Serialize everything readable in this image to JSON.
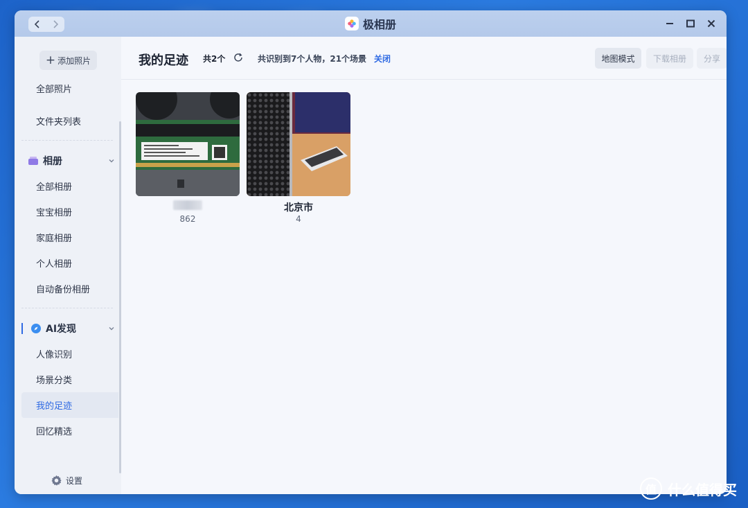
{
  "window": {
    "title": "极相册",
    "colors": {
      "accent": "#2f6ae3",
      "titlebar": "#b8cdec",
      "sidebar": "#eef1f7",
      "content": "#f5f7fc"
    }
  },
  "sidebar": {
    "add_photo": "添加照片",
    "items_top": [
      {
        "label": "全部照片"
      },
      {
        "label": "文件夹列表"
      }
    ],
    "album_group": {
      "title": "相册",
      "items": [
        {
          "label": "全部相册"
        },
        {
          "label": "宝宝相册"
        },
        {
          "label": "家庭相册"
        },
        {
          "label": "个人相册"
        },
        {
          "label": "自动备份相册"
        }
      ]
    },
    "ai_group": {
      "title": "AI发现",
      "items": [
        {
          "label": "人像识别"
        },
        {
          "label": "场景分类"
        },
        {
          "label": "我的足迹",
          "active": true
        },
        {
          "label": "回忆精选"
        }
      ]
    },
    "settings": "设置"
  },
  "toolbar": {
    "page_title": "我的足迹",
    "count": "共2个",
    "recognized": "共识别到7个人物，21个场景",
    "close_link": "关闭",
    "map_mode": "地图模式",
    "download": "下载相册",
    "share": "分享"
  },
  "places": [
    {
      "name": "",
      "count": "862",
      "icon": "ram-module-photo"
    },
    {
      "name": "北京市",
      "count": "4",
      "icon": "mac-pro-photo"
    }
  ],
  "watermark": "什么值得买"
}
